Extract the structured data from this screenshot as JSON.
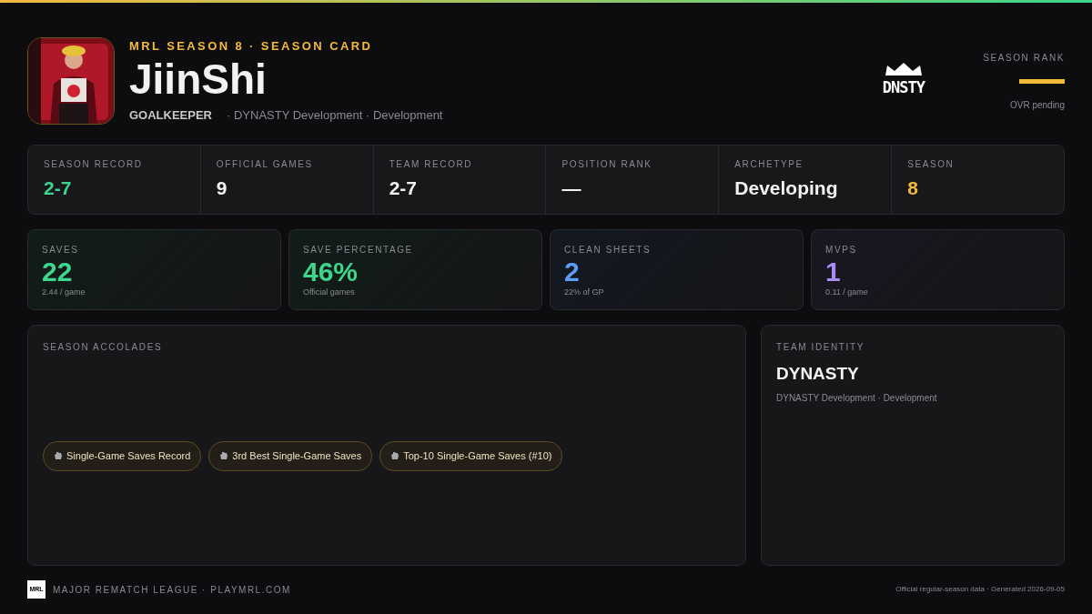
{
  "header": {
    "eyebrow": "MRL SEASON 8 · SEASON CARD",
    "player": "JiinShi",
    "position": "GOALKEEPER",
    "team_line": "· DYNASTY Development · Development",
    "team_logo": "DNSTY",
    "rank_label": "SEASON RANK",
    "rank_note": "OVR pending"
  },
  "summary": [
    {
      "label": "SEASON RECORD",
      "value": "2-7",
      "color": "#3dd68c"
    },
    {
      "label": "OFFICIAL GAMES",
      "value": "9",
      "color": "#f2f2f3"
    },
    {
      "label": "TEAM RECORD",
      "value": "2-7",
      "color": "#f2f2f3"
    },
    {
      "label": "POSITION RANK",
      "value": "—",
      "color": "#f2f2f3"
    },
    {
      "label": "ARCHETYPE",
      "value": "Developing",
      "color": "#f2f2f3"
    },
    {
      "label": "SEASON",
      "value": "8",
      "color": "#f5b93e"
    }
  ],
  "stats": [
    {
      "label": "SAVES",
      "value": "22",
      "note": "2.44 / game",
      "color": "#3dd68c"
    },
    {
      "label": "SAVE PERCENTAGE",
      "value": "46%",
      "note": "Official games",
      "color": "#3dd68c"
    },
    {
      "label": "CLEAN SHEETS",
      "value": "2",
      "note": "22% of GP",
      "color": "#5b9cf6"
    },
    {
      "label": "MVPS",
      "value": "1",
      "note": "0.11 / game",
      "color": "#a98bf5"
    }
  ],
  "accolades": {
    "title": "SEASON ACCOLADES",
    "items": [
      "Single-Game Saves Record",
      "3rd Best Single-Game Saves",
      "Top-10 Single-Game Saves (#10)"
    ]
  },
  "team_identity": {
    "title": "TEAM IDENTITY",
    "name": "DYNASTY",
    "detail": "DYNASTY Development · Development"
  },
  "footer": {
    "logo": "MRL",
    "league": "MAJOR REMATCH LEAGUE · PLAYMRL.COM",
    "note": "Official regular-season data · Generated 2026-09-05"
  }
}
